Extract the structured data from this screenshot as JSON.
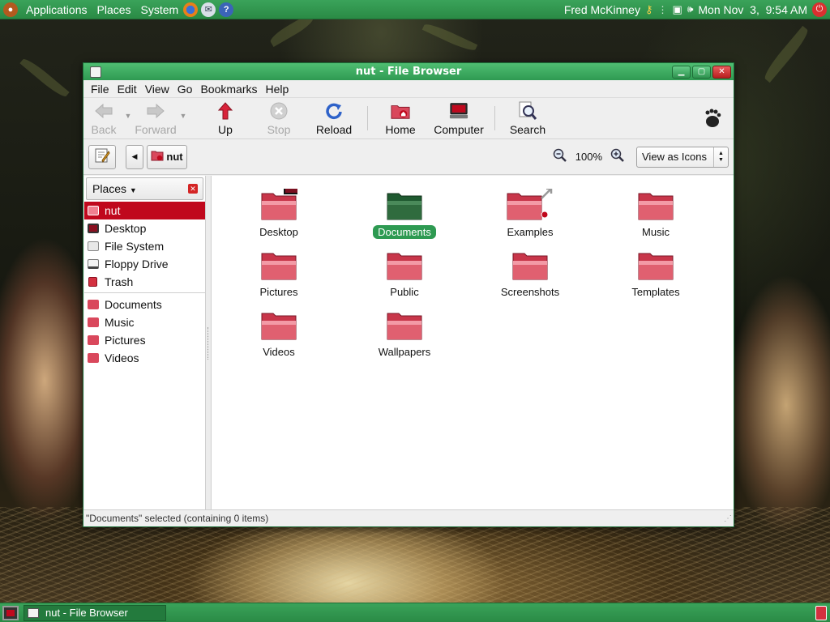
{
  "top_panel": {
    "menus": [
      "Applications",
      "Places",
      "System"
    ],
    "launchers": [
      "firefox-icon",
      "mail-icon",
      "help-icon"
    ],
    "user_name": "Fred McKinney",
    "clock": "Mon Nov  3,  9:54 AM"
  },
  "window": {
    "title": "nut - File Browser",
    "menu": [
      "File",
      "Edit",
      "View",
      "Go",
      "Bookmarks",
      "Help"
    ],
    "toolbar": {
      "back": "Back",
      "forward": "Forward",
      "up": "Up",
      "stop": "Stop",
      "reload": "Reload",
      "home": "Home",
      "computer": "Computer",
      "search": "Search"
    },
    "location": {
      "path_button": "nut",
      "zoom": "100%",
      "view_mode": "View as Icons"
    },
    "sidebar": {
      "header": "Places",
      "devices": [
        {
          "label": "nut",
          "icon": "home-folder-icon",
          "selected": true
        },
        {
          "label": "Desktop",
          "icon": "desktop-icon"
        },
        {
          "label": "File System",
          "icon": "filesystem-icon"
        },
        {
          "label": "Floppy Drive",
          "icon": "floppy-icon"
        },
        {
          "label": "Trash",
          "icon": "trash-icon"
        }
      ],
      "bookmarks": [
        {
          "label": "Documents",
          "icon": "folder-icon"
        },
        {
          "label": "Music",
          "icon": "folder-icon"
        },
        {
          "label": "Pictures",
          "icon": "folder-icon"
        },
        {
          "label": "Videos",
          "icon": "folder-icon"
        }
      ]
    },
    "files": [
      {
        "label": "Desktop",
        "icon": "desktop-folder-icon"
      },
      {
        "label": "Documents",
        "icon": "folder-icon",
        "selected": true
      },
      {
        "label": "Examples",
        "icon": "folder-link-icon"
      },
      {
        "label": "Music",
        "icon": "folder-icon"
      },
      {
        "label": "Pictures",
        "icon": "folder-icon"
      },
      {
        "label": "Public",
        "icon": "folder-icon"
      },
      {
        "label": "Screenshots",
        "icon": "folder-icon"
      },
      {
        "label": "Templates",
        "icon": "folder-icon"
      },
      {
        "label": "Videos",
        "icon": "folder-icon"
      },
      {
        "label": "Wallpapers",
        "icon": "folder-icon"
      }
    ],
    "status": "\"Documents\" selected (containing 0 items)"
  },
  "bottom_panel": {
    "task": "nut - File Browser"
  },
  "colors": {
    "panel_green": "#2f9a52",
    "selection_red": "#c0081d",
    "selection_green": "#2e9a52",
    "folder_red": "#d9485c",
    "folder_green": "#2f6b3e"
  }
}
